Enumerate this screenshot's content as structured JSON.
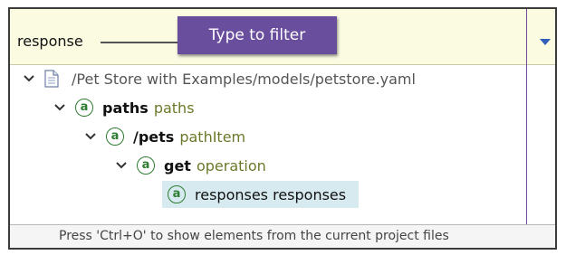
{
  "filter": {
    "value": "response",
    "callout": "Type to filter"
  },
  "tree": {
    "root_path": "/Pet Store with Examples/models/petstore.yaml",
    "items": [
      {
        "name": "paths",
        "type": "paths"
      },
      {
        "name": "/pets",
        "type": "pathItem"
      },
      {
        "name": "get",
        "type": "operation"
      },
      {
        "name": "responses",
        "type": "responses"
      }
    ],
    "selected_label": "responses responses"
  },
  "status": {
    "text": "Press 'Ctrl+O' to show elements from the current project files"
  },
  "colors": {
    "callout_bg": "#6a4e9e",
    "filter_bg": "#fbfbe2",
    "type_color": "#6a7a2a",
    "selection_bg": "#d6eaf0",
    "icon_green": "#2e7d32"
  }
}
